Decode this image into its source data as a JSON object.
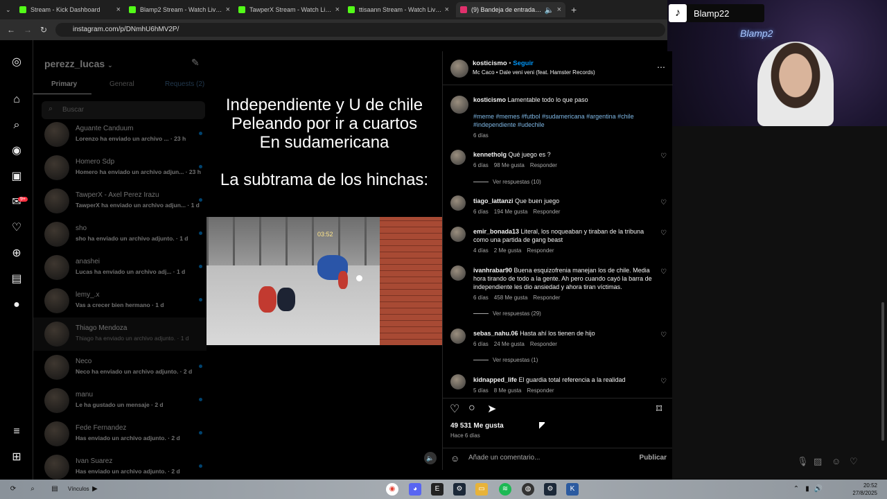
{
  "browser": {
    "tabs": [
      {
        "title": "Stream - Kick Dashboard",
        "color": "#53fc18"
      },
      {
        "title": "Blamp2 Stream - Watch Live on",
        "color": "#53fc18"
      },
      {
        "title": "TawperX Stream - Watch Live on",
        "color": "#53fc18"
      },
      {
        "title": "ttisaann Stream - Watch Live on",
        "color": "#53fc18"
      },
      {
        "title": "(9) Bandeja de entrada • Ch",
        "color": "#e1306c"
      }
    ],
    "url": "instagram.com/p/DNmhU6hMV2P/"
  },
  "webcam": {
    "tiktok_name": "Blamp22",
    "neon_sign": "Blamp2"
  },
  "sidebar": {
    "badge_reels": "9+"
  },
  "dm": {
    "username": "perezz_lucas",
    "tabs": {
      "primary": "Primary",
      "general": "General",
      "requests": "Requests (2)"
    },
    "search_placeholder": "Buscar",
    "chats": [
      {
        "name": "Aguante Canduum",
        "preview": "Lorenzo ha enviado un archivo ...",
        "time": "· 23 h"
      },
      {
        "name": "Homero Sdp",
        "preview": "Homero ha enviado un archivo adjun...",
        "time": "· 23 h"
      },
      {
        "name": "TawperX - Axel Perez Irazu",
        "preview": "TawperX ha enviado un archivo adjun...",
        "time": "· 1 d"
      },
      {
        "name": "sho",
        "preview": "sho ha enviado un archivo adjunto.",
        "time": "· 1 d"
      },
      {
        "name": "anashei",
        "preview": "Lucas ha enviado un archivo adj...",
        "time": "· 1 d"
      },
      {
        "name": "lemy_.x",
        "preview": "Vas a crecer bien hermano",
        "time": "· 1 d"
      },
      {
        "name": "Thiago Mendoza",
        "preview": "Thiago ha enviado un archivo adjunto.",
        "time": "· 1 d"
      },
      {
        "name": "Neco",
        "preview": "Neco ha enviado un archivo adjunto.",
        "time": "· 2 d"
      },
      {
        "name": "manu",
        "preview": "Le ha gustado un mensaje",
        "time": "· 2 d"
      },
      {
        "name": "Fede Fernandez",
        "preview": "Has enviado un archivo adjunto.",
        "time": "· 2 d"
      },
      {
        "name": "Ivan Suarez",
        "preview": "Has enviado un archivo adjunto.",
        "time": "· 2 d"
      }
    ]
  },
  "post": {
    "caption_lines": [
      "Independiente y U de chile",
      "Peleando por ir a cuartos",
      "En sudamericana",
      "",
      "La subtrama de los hinchas:"
    ],
    "video_timer": "03:52",
    "author": "kosticismo",
    "follow": "Seguir",
    "audio": "Mc Caco • Dale veni veni (feat. Hamster Records)",
    "desc_text": "Lamentable todo lo que paso",
    "hashtags": "#meme #memes #futbol #sudamericana #argentina #chile #independiente #udechile",
    "desc_time": "6 días",
    "likes": "49 531 Me gusta",
    "ago": "Hace 6 días",
    "comment_placeholder": "Añade un comentario...",
    "publish": "Publicar"
  },
  "comments": [
    {
      "user": "kennetholg",
      "text": "Qué juego es ?",
      "time": "6 días",
      "likes": "98 Me gusta",
      "reply": "Responder",
      "view": "Ver respuestas (10)"
    },
    {
      "user": "tiago_lattanzi",
      "text": "Que buen juego",
      "time": "6 días",
      "likes": "194 Me gusta",
      "reply": "Responder",
      "view": ""
    },
    {
      "user": "emir_bonada13",
      "text": "Literal, los noqueaban y tiraban de la tribuna como una partida de gang beast",
      "time": "4 días",
      "likes": "2 Me gusta",
      "reply": "Responder",
      "view": ""
    },
    {
      "user": "ivanhrabar90",
      "text": "Buena esquizofrenia manejan los de chile. Media hora tirando de todo a la gente. Ah pero cuando cayó la barra de independiente les dio ansiedad y ahora tiran víctimas.",
      "time": "6 días",
      "likes": "458 Me gusta",
      "reply": "Responder",
      "view": "Ver respuestas (29)"
    },
    {
      "user": "sebas_nahu.06",
      "text": "Hasta ahí los tienen de hijo",
      "time": "6 días",
      "likes": "24 Me gusta",
      "reply": "Responder",
      "view": "Ver respuestas (1)"
    },
    {
      "user": "kidnapped_life",
      "text": "El guardia total referencia a la realidad",
      "time": "5 días",
      "likes": "8 Me gusta",
      "reply": "Responder",
      "view": ""
    }
  ],
  "taskbar": {
    "links_label": "Vínculos",
    "time": "20:52",
    "date": "27/8/2025"
  },
  "colors": {
    "accent": "#0095f6",
    "badge": "#ff3040"
  }
}
